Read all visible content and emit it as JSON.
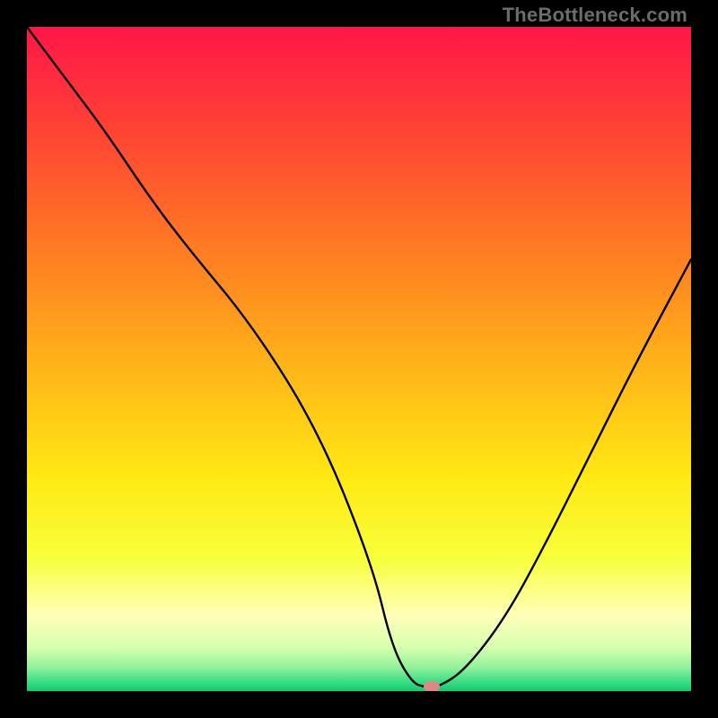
{
  "watermark": "TheBottleneck.com",
  "chart_data": {
    "type": "line",
    "title": "",
    "xlabel": "",
    "ylabel": "",
    "xlim": [
      0,
      100
    ],
    "ylim": [
      0,
      100
    ],
    "gradient_stops": [
      {
        "offset": 0.0,
        "color": "#ff1649"
      },
      {
        "offset": 0.16,
        "color": "#ff4433"
      },
      {
        "offset": 0.34,
        "color": "#ff7d23"
      },
      {
        "offset": 0.52,
        "color": "#ffb718"
      },
      {
        "offset": 0.68,
        "color": "#ffe914"
      },
      {
        "offset": 0.8,
        "color": "#f8ff3a"
      },
      {
        "offset": 0.885,
        "color": "#ffffb8"
      },
      {
        "offset": 0.935,
        "color": "#d6ffb0"
      },
      {
        "offset": 0.965,
        "color": "#8ff29a"
      },
      {
        "offset": 0.985,
        "color": "#3ddf86"
      },
      {
        "offset": 1.0,
        "color": "#14c96f"
      }
    ],
    "series": [
      {
        "name": "bottleneck-curve",
        "x": [
          0,
          6,
          12,
          18,
          24,
          34,
          44,
          52,
          55,
          58,
          60,
          62,
          66,
          72,
          78,
          85,
          92,
          100
        ],
        "y": [
          100,
          92,
          84,
          75,
          67,
          55,
          39,
          19,
          6.5,
          1.2,
          0.6,
          0.6,
          3.2,
          11,
          22,
          36,
          50,
          65
        ]
      }
    ],
    "marker": {
      "x": 61,
      "y": 0.7
    }
  }
}
